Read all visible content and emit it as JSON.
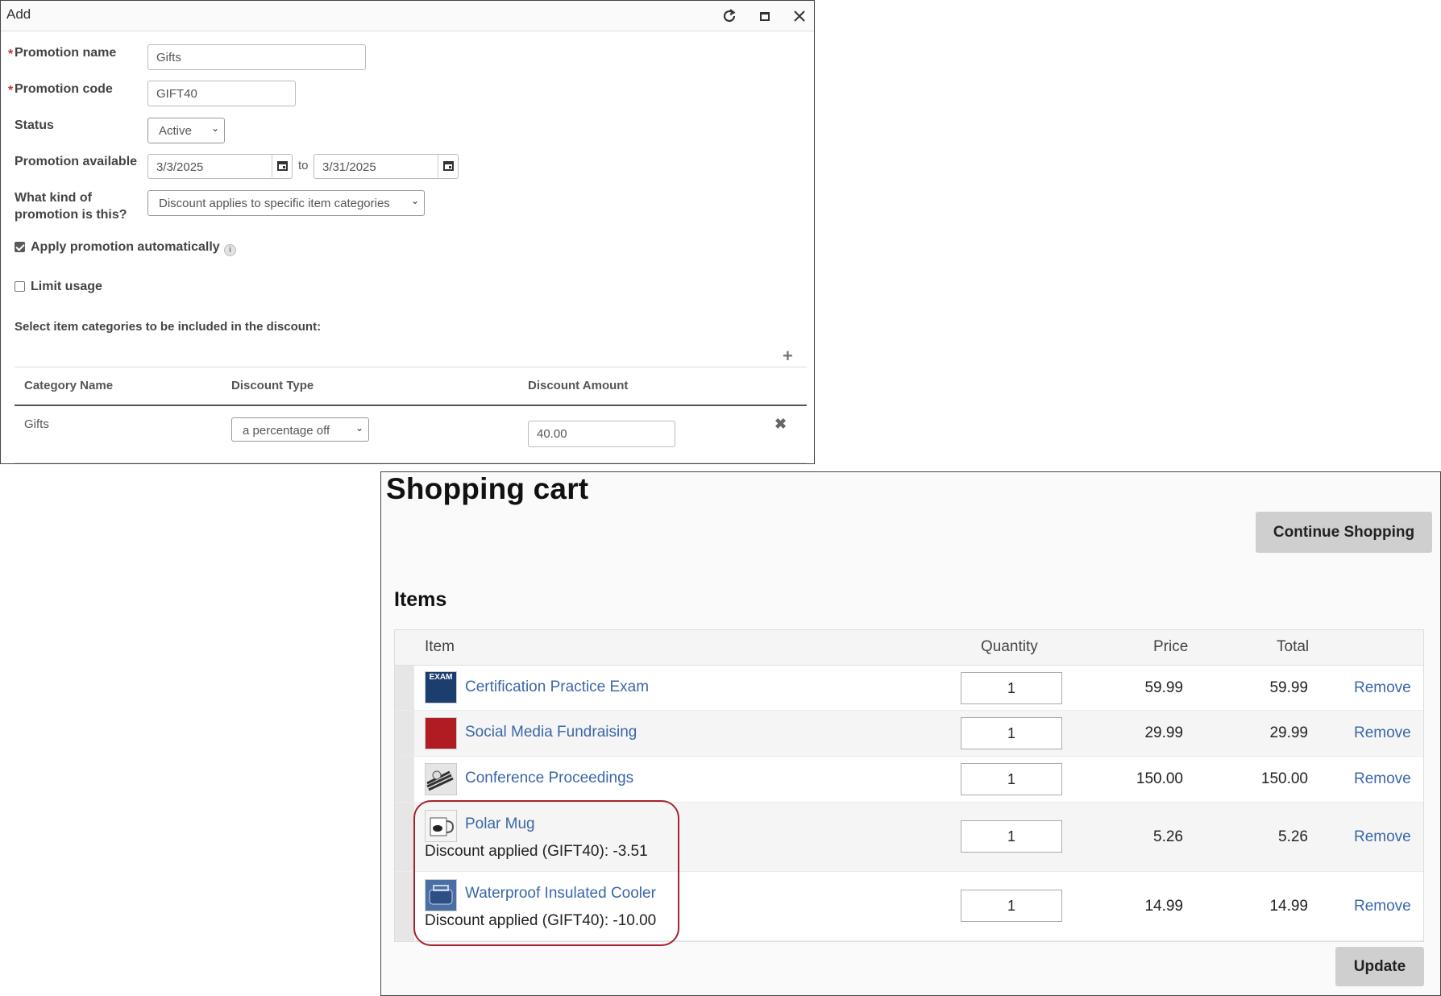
{
  "dialog": {
    "title": "Add",
    "fields": {
      "promotion_name_label": "Promotion name",
      "promotion_name_value": "Gifts",
      "promotion_code_label": "Promotion code",
      "promotion_code_value": "GIFT40",
      "status_label": "Status",
      "status_value": "Active",
      "available_label": "Promotion available",
      "available_from": "3/3/2025",
      "available_to_word": "to",
      "available_to": "3/31/2025",
      "kind_label_line1": "What kind of",
      "kind_label_line2": "promotion is this?",
      "kind_value": "Discount applies to specific item categories",
      "apply_auto_label": "Apply promotion automatically",
      "apply_auto_checked": true,
      "limit_usage_label": "Limit usage",
      "limit_usage_checked": false,
      "categories_prompt": "Select item categories to be included in the discount:"
    },
    "category_table": {
      "headers": [
        "Category Name",
        "Discount Type",
        "Discount Amount"
      ],
      "rows": [
        {
          "category": "Gifts",
          "discount_type": "a percentage off",
          "discount_amount": "40.00"
        }
      ]
    },
    "icons": [
      "refresh-icon",
      "maximize-icon",
      "close-icon",
      "calendar-icon",
      "info-icon",
      "plus-icon",
      "remove-x-icon"
    ]
  },
  "cart": {
    "title": "Shopping cart",
    "continue_label": "Continue Shopping",
    "items_heading": "Items",
    "headers": {
      "item": "Item",
      "quantity": "Quantity",
      "price": "Price",
      "total": "Total"
    },
    "remove_label": "Remove",
    "update_label": "Update",
    "items": [
      {
        "name": "Certification Practice Exam",
        "qty": "1",
        "price": "59.99",
        "total": "59.99",
        "discount": ""
      },
      {
        "name": "Social Media Fundraising",
        "qty": "1",
        "price": "29.99",
        "total": "29.99",
        "discount": ""
      },
      {
        "name": "Conference Proceedings",
        "qty": "1",
        "price": "150.00",
        "total": "150.00",
        "discount": ""
      },
      {
        "name": "Polar Mug",
        "qty": "1",
        "price": "5.26",
        "total": "5.26",
        "discount": "Discount applied (GIFT40): -3.51"
      },
      {
        "name": "Waterproof Insulated Cooler",
        "qty": "1",
        "price": "14.99",
        "total": "14.99",
        "discount": "Discount applied (GIFT40): -10.00"
      }
    ],
    "exam_thumb_text": "EXAM",
    "highlight_color": "#a3242e",
    "link_color": "#3b67a8"
  }
}
